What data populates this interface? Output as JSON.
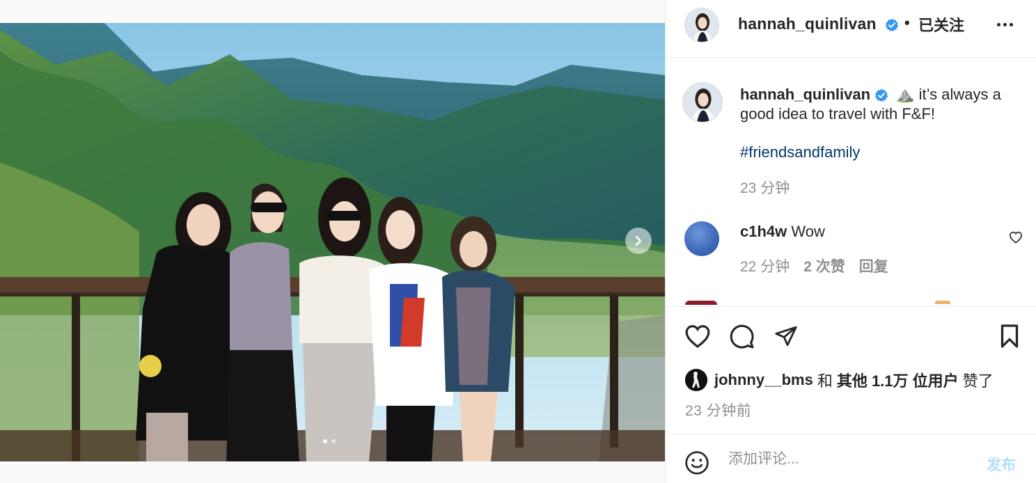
{
  "post": {
    "username": "hannah_quinlivan",
    "header_separator": "•",
    "follow_label": "已关注",
    "more_icon": "more-horizontal-icon",
    "verified_icon": "verified-badge-icon"
  },
  "caption": {
    "username": "hannah_quinlivan",
    "text": "⛰️ it’s always a good idea to travel with F&F!",
    "hashtag": "#friendsandfamily",
    "time": "23 分钟"
  },
  "comments": [
    {
      "username": "c1h4w",
      "text": "Wow",
      "time": "22 分钟",
      "likes": "2 次赞",
      "reply_label": "回复"
    }
  ],
  "likes": {
    "liker": "johnny__bms",
    "conj": "和",
    "others": "其他 1.1万 位用户",
    "suffix": "赞了"
  },
  "post_time": "23 分钟前",
  "comment_box": {
    "placeholder": "添加评论...",
    "post_label": "发布"
  },
  "carousel": {
    "total_slides": 2,
    "current_slide": 1
  },
  "colors": {
    "link": "#00376b",
    "muted": "#8e8e8e",
    "verified": "#3897f0",
    "post_disabled": "#b2dffc"
  }
}
